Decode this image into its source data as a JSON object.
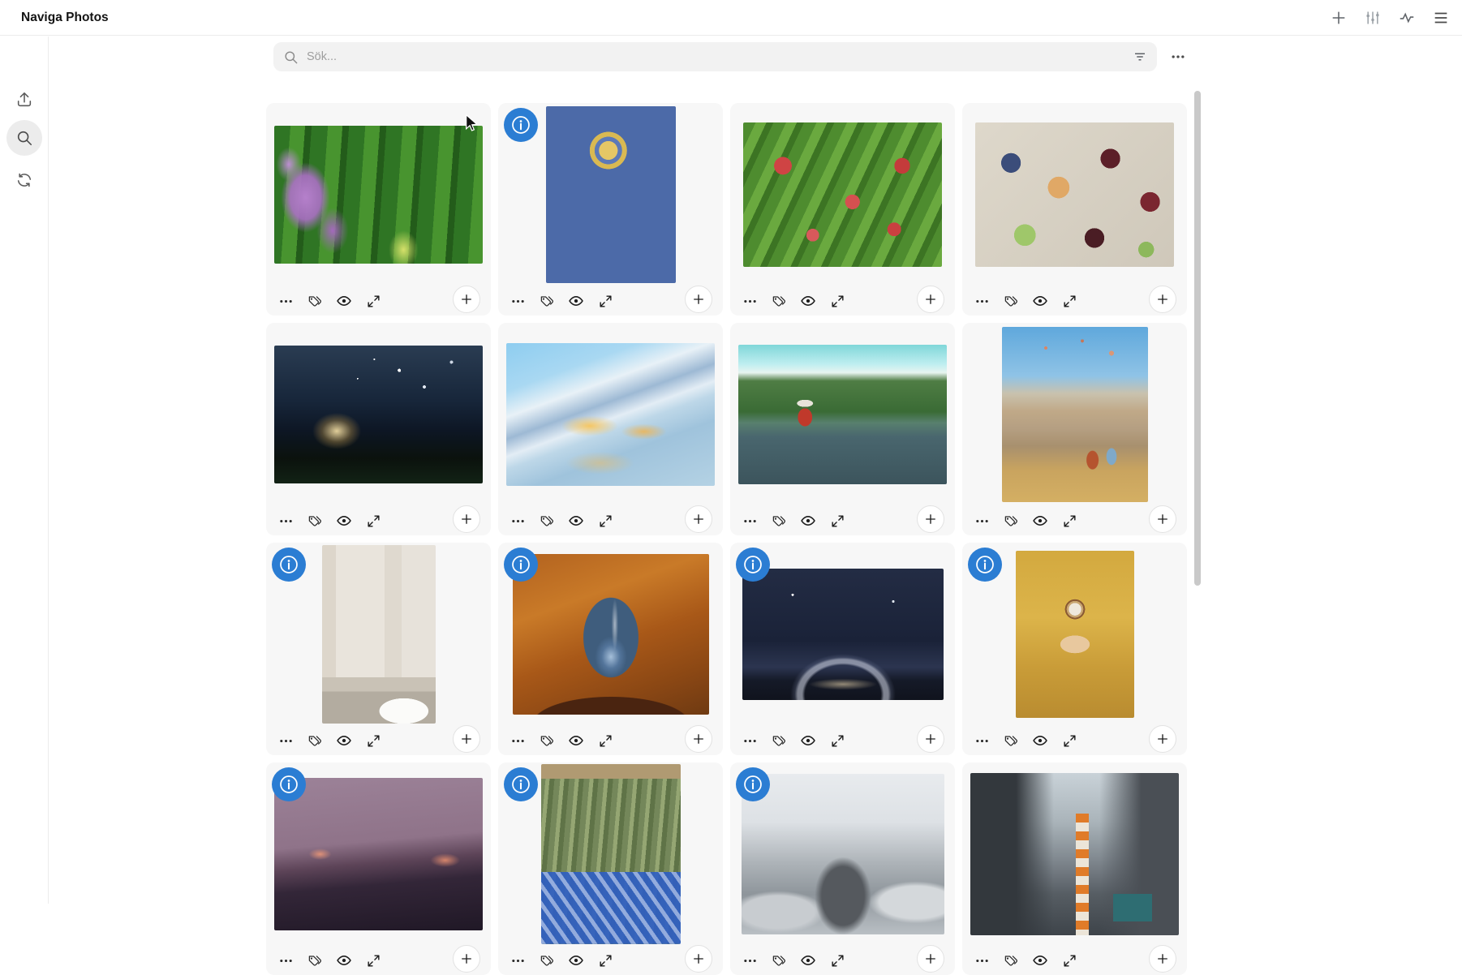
{
  "app": {
    "title": "Naviga Photos"
  },
  "topbar": {
    "icons": [
      {
        "name": "add-icon"
      },
      {
        "name": "sliders-icon"
      },
      {
        "name": "activity-icon"
      },
      {
        "name": "menu-icon"
      }
    ]
  },
  "sidebar": {
    "items": [
      {
        "name": "upload-icon",
        "active": false
      },
      {
        "name": "search-icon",
        "active": true
      },
      {
        "name": "sync-icon",
        "active": false
      }
    ],
    "active_background": "#ececec"
  },
  "search": {
    "placeholder": "Sök...",
    "value": "",
    "leading_icon": "search-icon",
    "trailing_icon": "filter-icon",
    "overflow_icon": "more-options-icon"
  },
  "grid": {
    "columns": 4,
    "info_badge_color": "#2b7dd3",
    "card_background": "#f7f7f7",
    "card_actions": [
      "more-options",
      "tags",
      "preview",
      "expand",
      "add"
    ],
    "cards": [
      {
        "photo": "lilac-garden",
        "info_badge": false,
        "palette": [
          "#48942f",
          "#235c1a",
          "#b580cb"
        ]
      },
      {
        "photo": "hot-air-balloon",
        "info_badge": true,
        "palette": [
          "#9cc4e2",
          "#e5c766",
          "#5b79b8",
          "#c99e62"
        ]
      },
      {
        "photo": "apple-tree",
        "info_badge": false,
        "palette": [
          "#6aa93f",
          "#cf4444"
        ]
      },
      {
        "photo": "fruit-crates",
        "info_badge": false,
        "palette": [
          "#ded8cb",
          "#5c1f28",
          "#3b4d7a",
          "#9fc76a",
          "#e0a866"
        ]
      },
      {
        "photo": "night-shelter",
        "info_badge": false,
        "palette": [
          "#17263a",
          "#0b120d",
          "#ecd8a0"
        ]
      },
      {
        "photo": "snowy-fjord-village",
        "info_badge": false,
        "palette": [
          "#8ecdf0",
          "#e8f1f7",
          "#f5c45c",
          "#9fc3dc"
        ]
      },
      {
        "photo": "lakeside-cabin",
        "info_badge": false,
        "palette": [
          "#7fd6d8",
          "#3a6b35",
          "#c0392b",
          "#3c545c"
        ]
      },
      {
        "photo": "cappadocia-overlook",
        "info_badge": false,
        "palette": [
          "#5fa8dc",
          "#c0a988",
          "#d4af63",
          "#b5542f"
        ]
      },
      {
        "photo": "stone-bathroom",
        "info_badge": true,
        "palette": [
          "#e9e4dc",
          "#c9c2b6",
          "#fbfbf9"
        ]
      },
      {
        "photo": "desert-arch-stars",
        "info_badge": true,
        "palette": [
          "#c97a28",
          "#3f5d7d",
          "#4a2410"
        ]
      },
      {
        "photo": "milky-way-lake",
        "info_badge": true,
        "palette": [
          "#1a2238",
          "#d7dceb"
        ]
      },
      {
        "photo": "coffee-sweater",
        "info_badge": true,
        "palette": [
          "#d3a93f",
          "#efe8dc",
          "#8a5a33"
        ]
      },
      {
        "photo": "dusk-mountains",
        "info_badge": true,
        "palette": [
          "#9c8298",
          "#332638",
          "#e99678"
        ]
      },
      {
        "photo": "asparagus-crate",
        "info_badge": true,
        "palette": [
          "#8a9c6b",
          "#2f5fc2"
        ]
      },
      {
        "photo": "monochrome-peak",
        "info_badge": true,
        "palette": [
          "#e8ebee",
          "#55595e",
          "#d4d8db"
        ]
      },
      {
        "photo": "city-street-chimney",
        "info_badge": false,
        "palette": [
          "#e07b28",
          "#ece5d8",
          "#3e444a",
          "#2e6d72"
        ]
      }
    ]
  }
}
